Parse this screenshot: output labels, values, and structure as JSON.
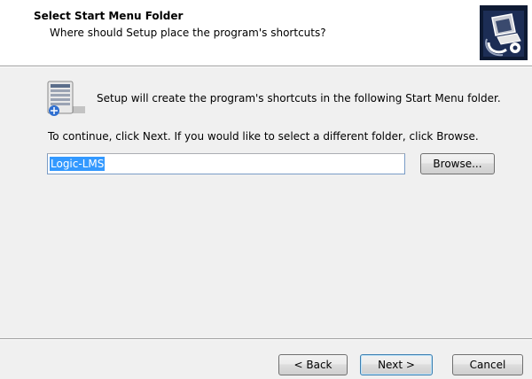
{
  "header": {
    "title": "Select Start Menu Folder",
    "subtitle": "Where should Setup place the program's shortcuts?",
    "icon": "installer-computer-icon"
  },
  "body": {
    "icon": "start-menu-folder-icon",
    "setup_text": "Setup will create the program's shortcuts in the following Start Menu folder.",
    "continue_text": "To continue, click Next. If you would like to select a different folder, click Browse.",
    "folder_value": "Logic-LMS",
    "browse_label": "Browse..."
  },
  "footer": {
    "back_label": "< Back",
    "next_label": "Next >",
    "cancel_label": "Cancel"
  },
  "colors": {
    "selection": "#3399ff",
    "header_bg": "#ffffff",
    "body_bg": "#f0f0f0",
    "default_button_border": "#3c7fb1"
  }
}
